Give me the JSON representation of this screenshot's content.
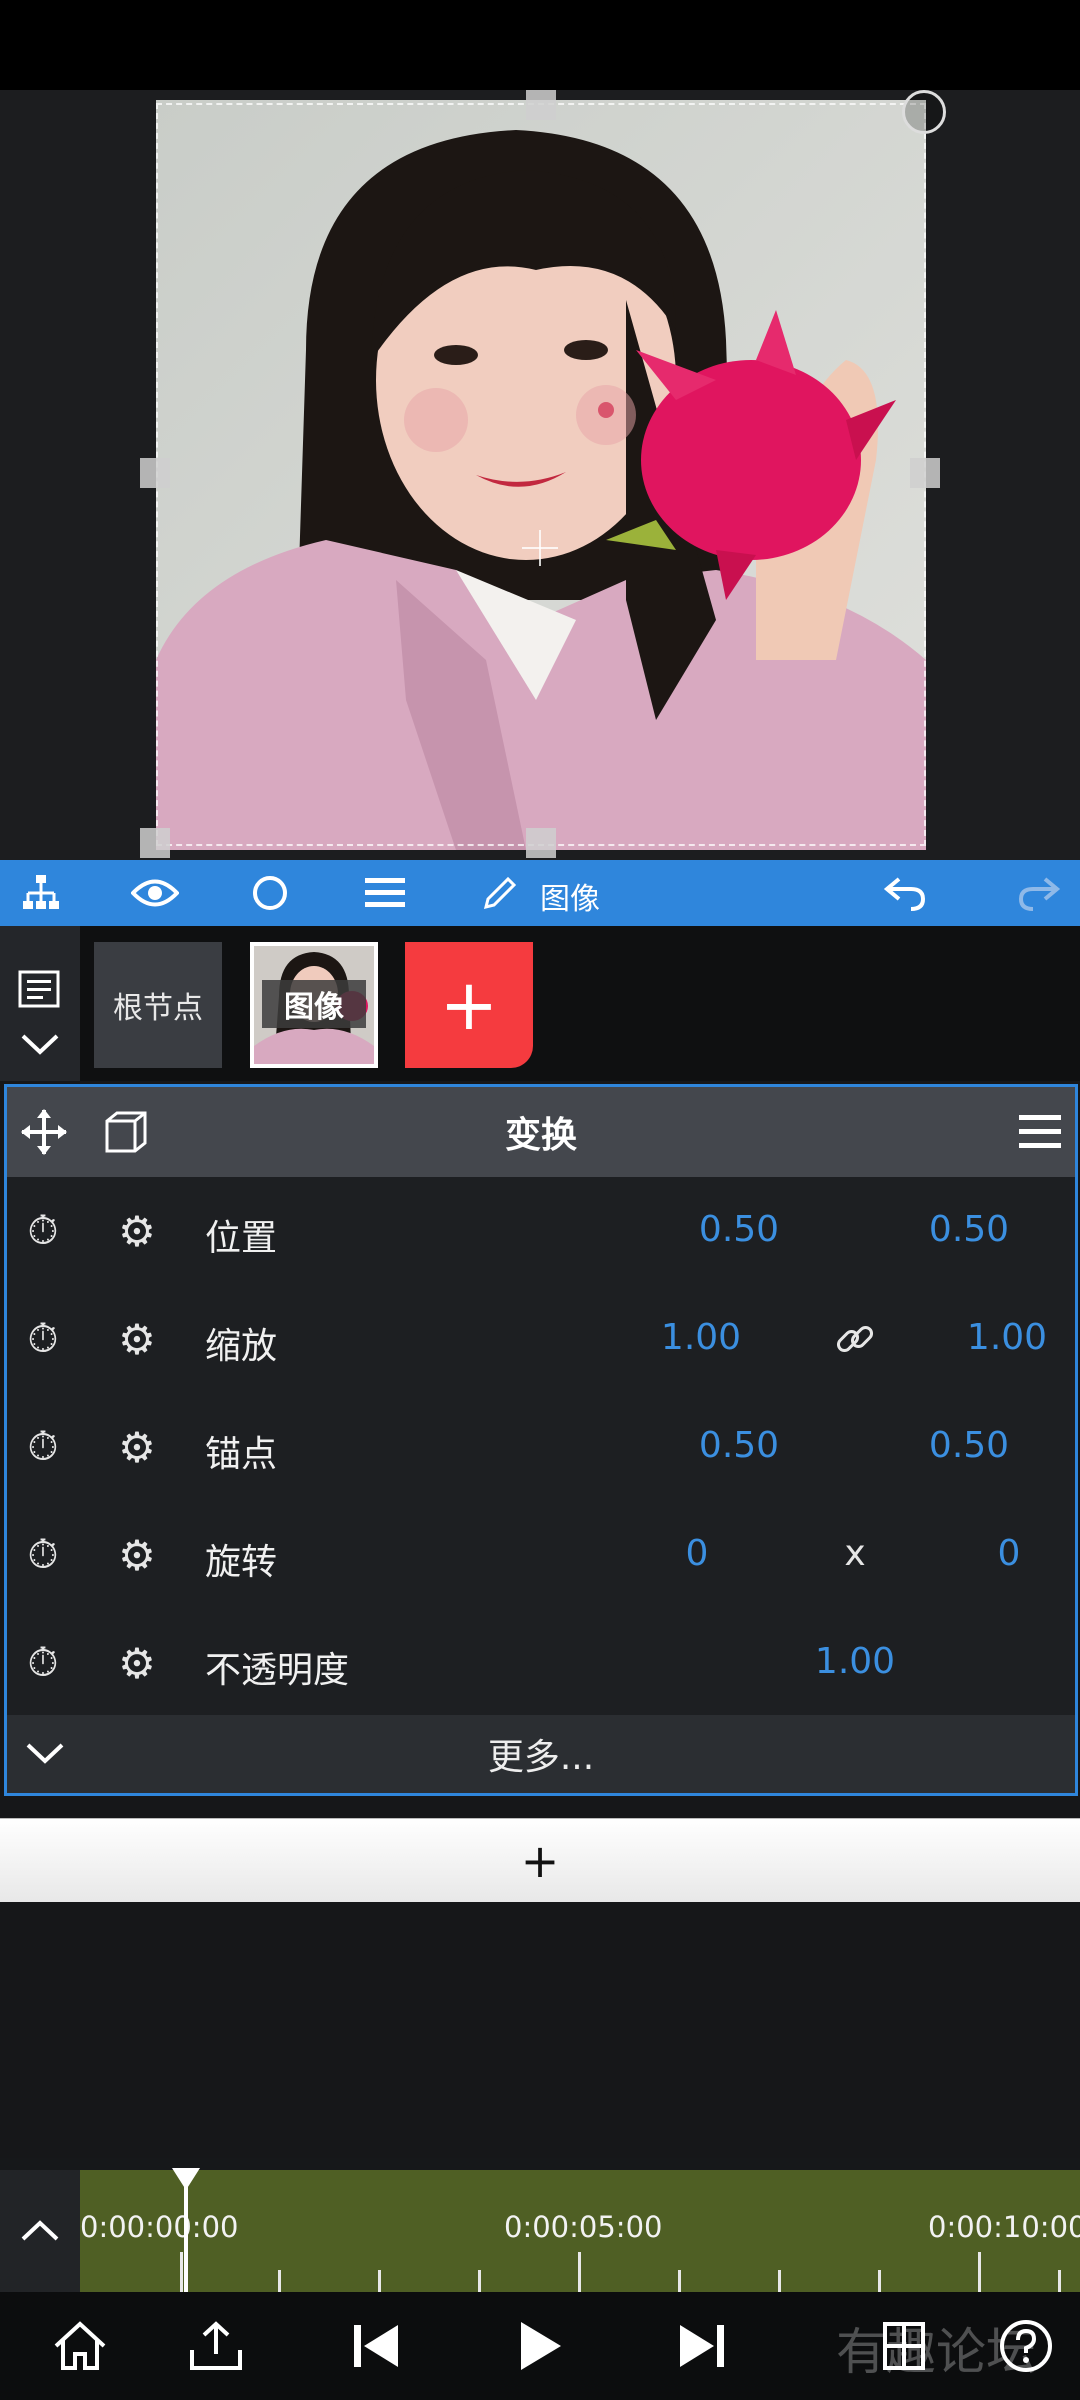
{
  "toolbar": {
    "label": "图像"
  },
  "nodes": {
    "root_label": "根节点",
    "image_label": "图像",
    "add_label": "+"
  },
  "panel": {
    "title": "变换",
    "rows": [
      {
        "label": "位置",
        "x": "0.50",
        "y": "0.50",
        "mid": ""
      },
      {
        "label": "缩放",
        "x": "1.00",
        "y": "1.00",
        "mid": "link"
      },
      {
        "label": "锚点",
        "x": "0.50",
        "y": "0.50",
        "mid": ""
      },
      {
        "label": "旋转",
        "x": "0",
        "y": "0",
        "mid": "x"
      },
      {
        "label": "不透明度",
        "value": "1.00"
      }
    ],
    "more_label": "更多..."
  },
  "add_layer_label": "+",
  "timeline": {
    "timecodes": [
      "0:00:00:00",
      "0:00:05:00",
      "0:00:10:00"
    ],
    "playhead": "0:00:00:00"
  },
  "watermark": "有趣论坛"
}
